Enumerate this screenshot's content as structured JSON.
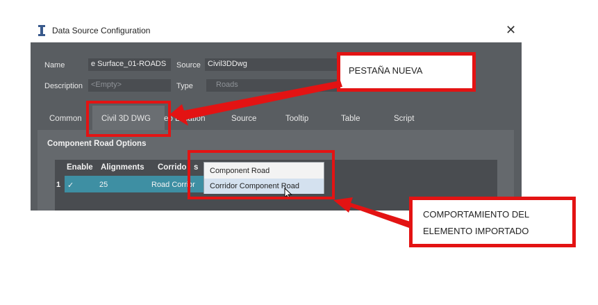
{
  "window": {
    "title": "Data Source Configuration",
    "close_glyph": "✕"
  },
  "form": {
    "name_label": "Name",
    "name_value": "e Surface_01-ROADS",
    "source_label": "Source",
    "source_value": "Civil3DDwg",
    "description_label": "Description",
    "description_placeholder": "<Empty>",
    "type_label": "Type",
    "type_value": "Roads"
  },
  "tabs": [
    {
      "label": "Common"
    },
    {
      "label": "Civil 3D DWG"
    },
    {
      "label": "eo Location"
    },
    {
      "label": "Source"
    },
    {
      "label": "Tooltip"
    },
    {
      "label": "Table"
    },
    {
      "label": "Script"
    }
  ],
  "section": {
    "title": "Component Road Options"
  },
  "grid": {
    "headers": [
      "Enable",
      "Alignments",
      "Corrido"
    ],
    "header_suffix": "s",
    "rows": [
      {
        "index": "1",
        "enable": "✓",
        "alignments": "25",
        "corridor": "Road Corrior"
      }
    ]
  },
  "dropdown": {
    "options": [
      "Component Road",
      "Corridor Component Road"
    ],
    "hover_index": 1
  },
  "annotations": {
    "tab_callout": "PESTAÑA NUEVA",
    "behavior_callout_line1": "COMPORTAMIENTO DEL",
    "behavior_callout_line2": "ELEMENTO IMPORTADO",
    "color": "#e31313"
  },
  "colors": {
    "panel": "#595d61",
    "selection": "#3e8fa3",
    "annotation_red": "#e31313"
  }
}
